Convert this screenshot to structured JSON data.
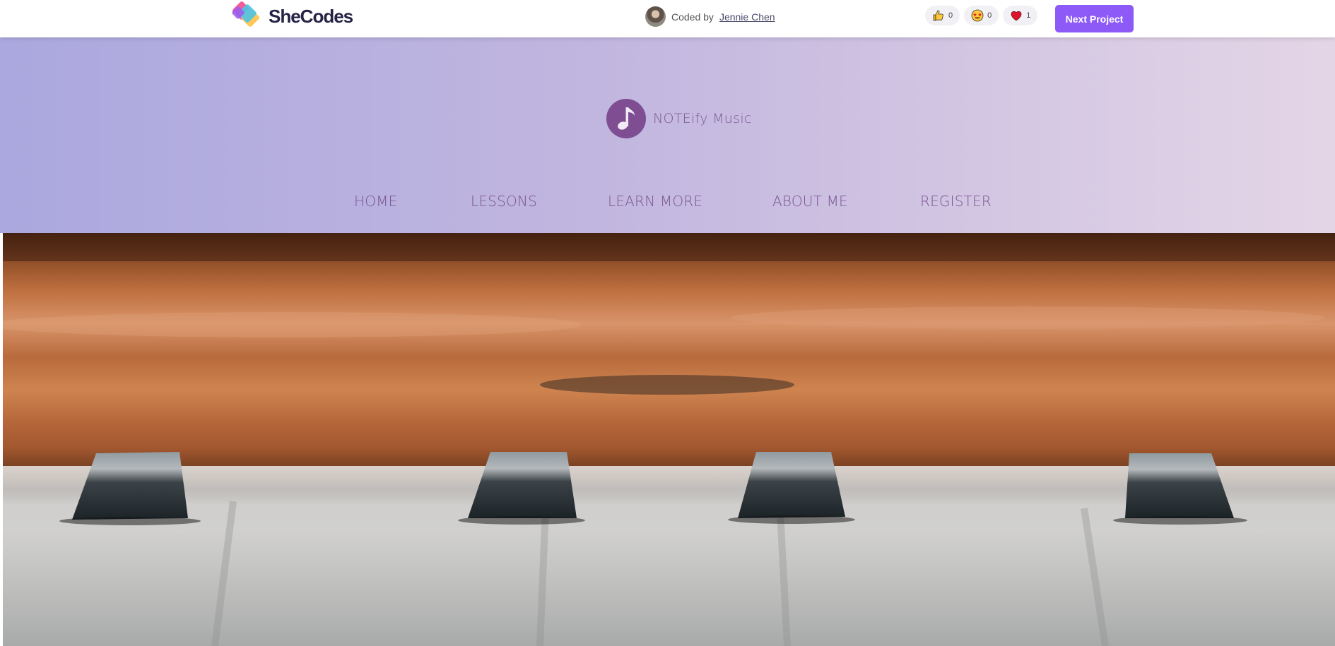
{
  "topbar": {
    "brand": "SheCodes",
    "coded_by_label": "Coded by",
    "author_name": "Jennie Chen",
    "reactions": [
      {
        "icon": "thumbs-up-icon",
        "count": "0"
      },
      {
        "icon": "star-struck-icon",
        "count": "0"
      },
      {
        "icon": "heart-icon",
        "count": "1"
      }
    ],
    "next_project_label": "Next Project",
    "accent_color": "#8e5af7"
  },
  "site": {
    "logo_icon": "music-note-icon",
    "name": "NOTEify Music",
    "nav": [
      "HOME",
      "LESSONS",
      "LEARN MORE",
      "ABOUT ME",
      "REGISTER"
    ]
  },
  "hero": {
    "image": "piano-keys-photo"
  }
}
